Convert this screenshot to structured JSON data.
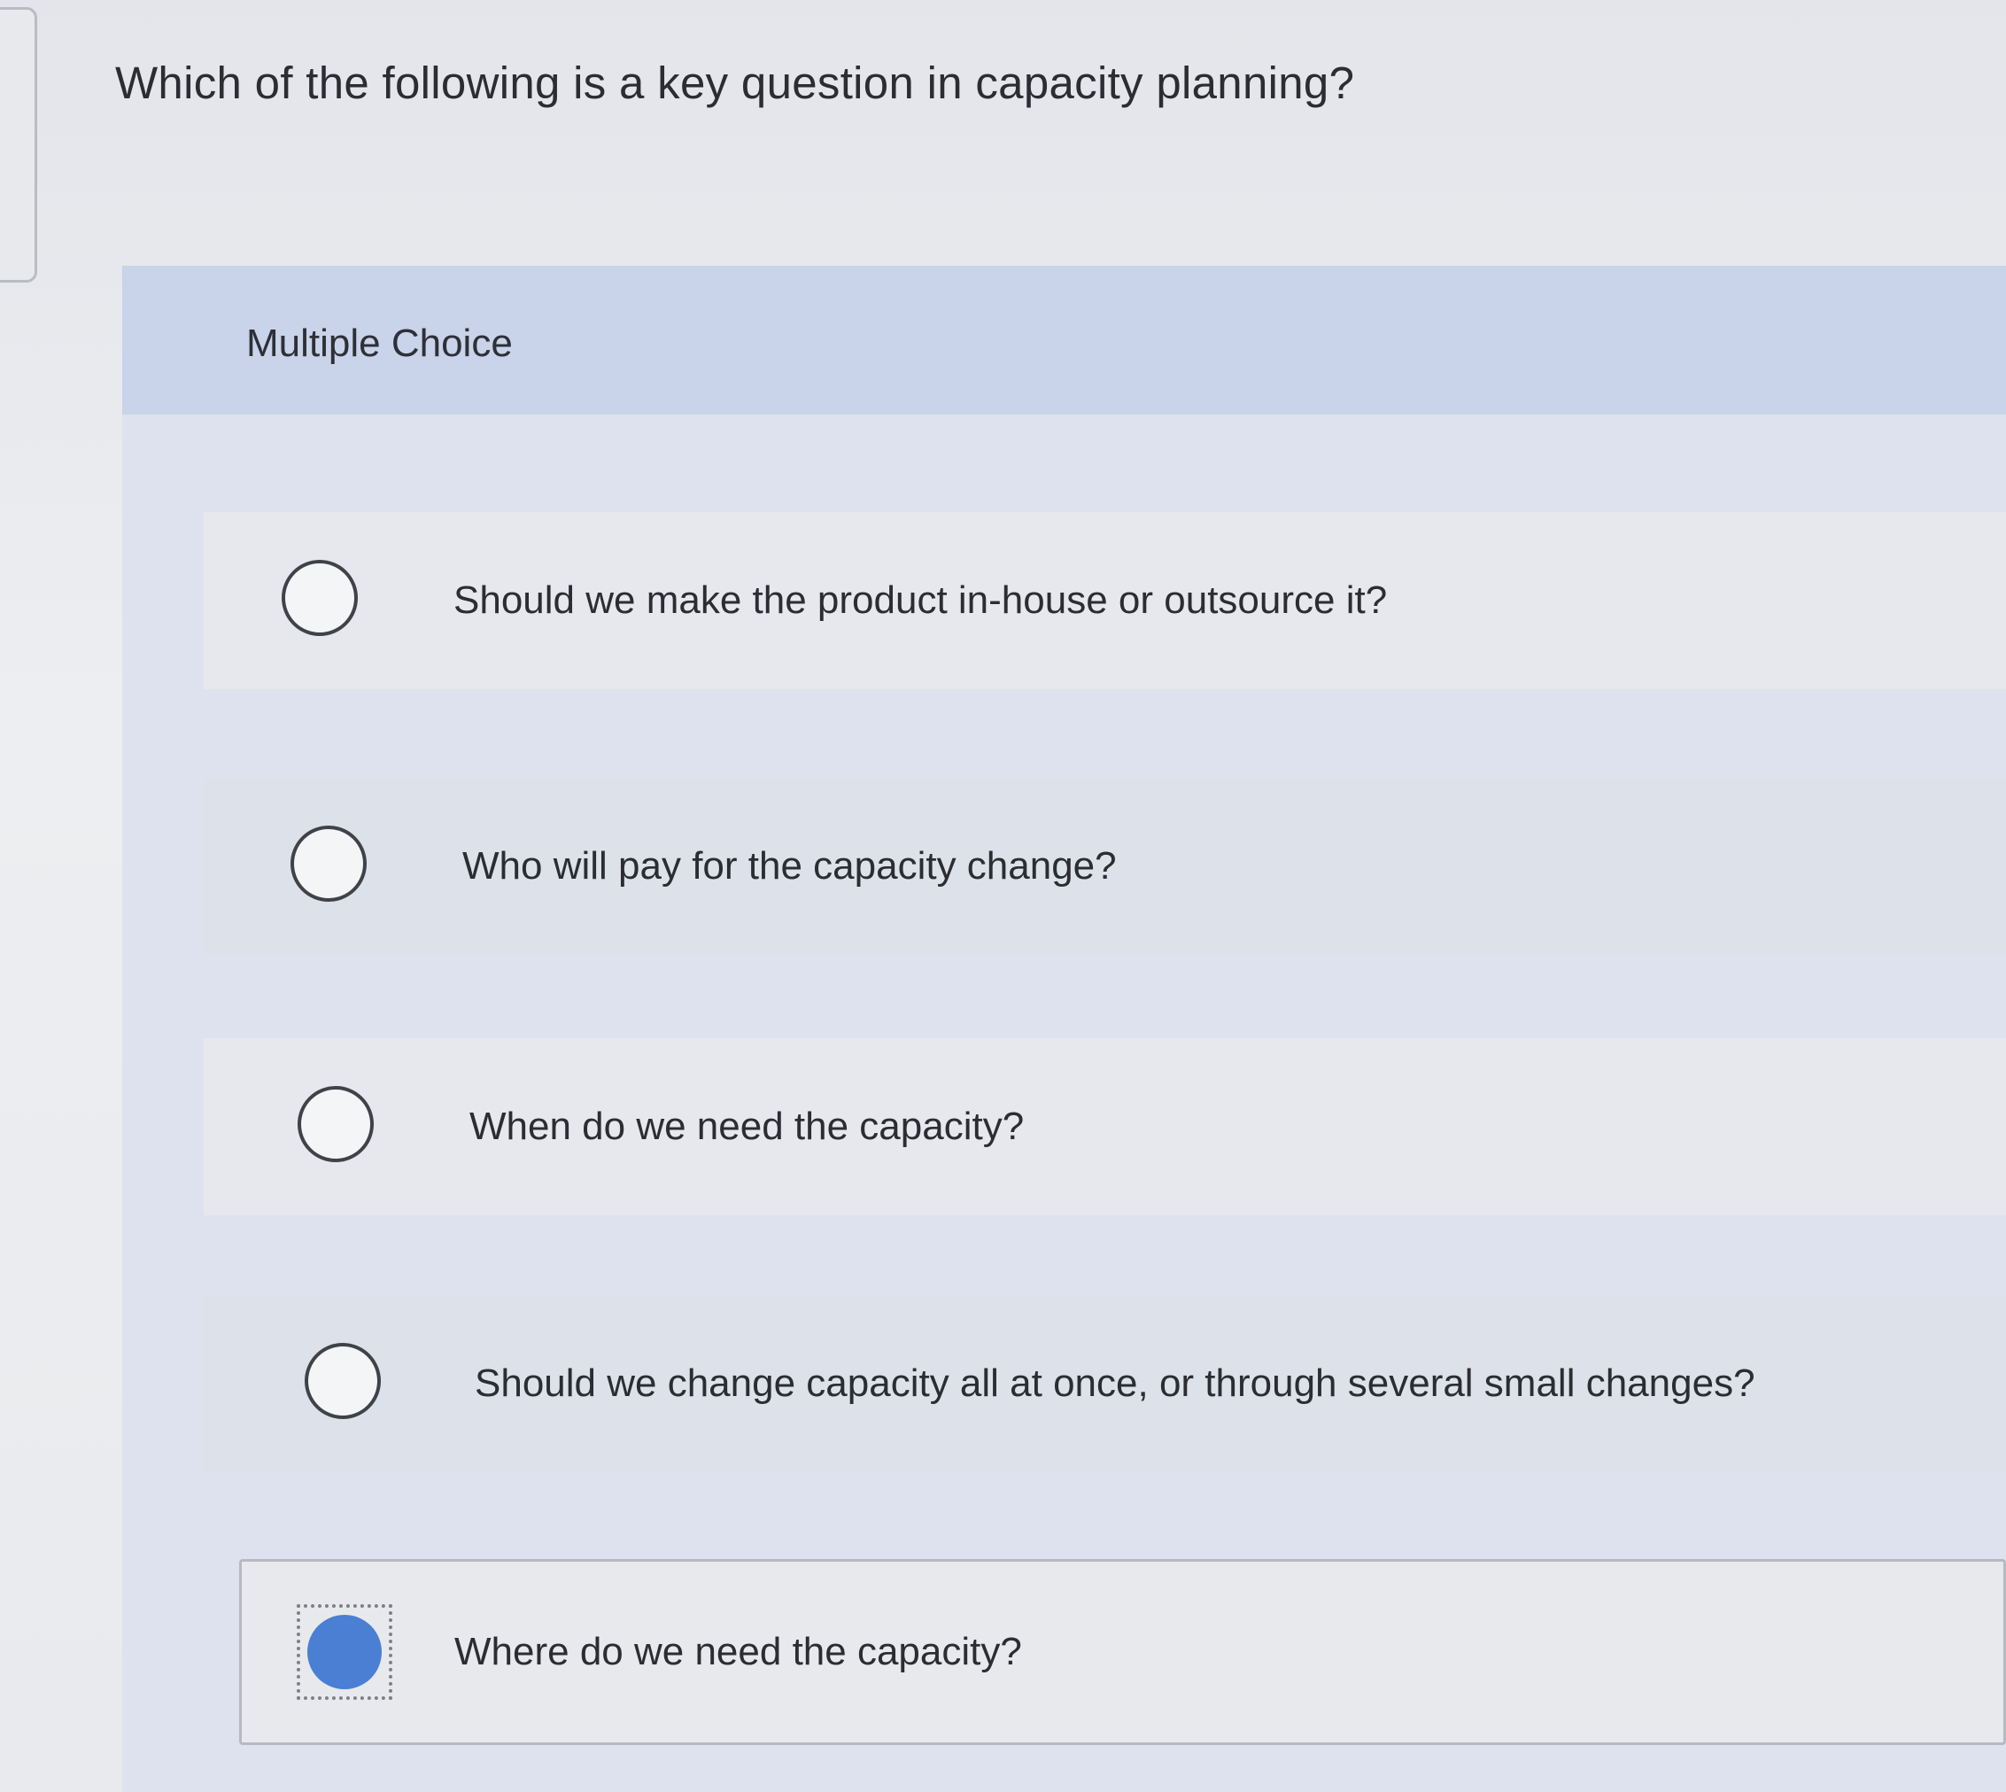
{
  "question": {
    "text": "Which of the following is a key question in capacity planning?"
  },
  "panel": {
    "title": "Multiple Choice"
  },
  "options": [
    {
      "label": "Should we make the product in-house or outsource it?",
      "selected": false
    },
    {
      "label": "Who will pay for the capacity change?",
      "selected": false
    },
    {
      "label": "When do we need the capacity?",
      "selected": false
    },
    {
      "label": "Should we change capacity all at once, or through several small changes?",
      "selected": false
    },
    {
      "label": "Where do we need the capacity?",
      "selected": true
    }
  ],
  "colors": {
    "header": "#c9d3e9",
    "selected_radio": "#4a7fd4",
    "text": "#2b2d33"
  }
}
